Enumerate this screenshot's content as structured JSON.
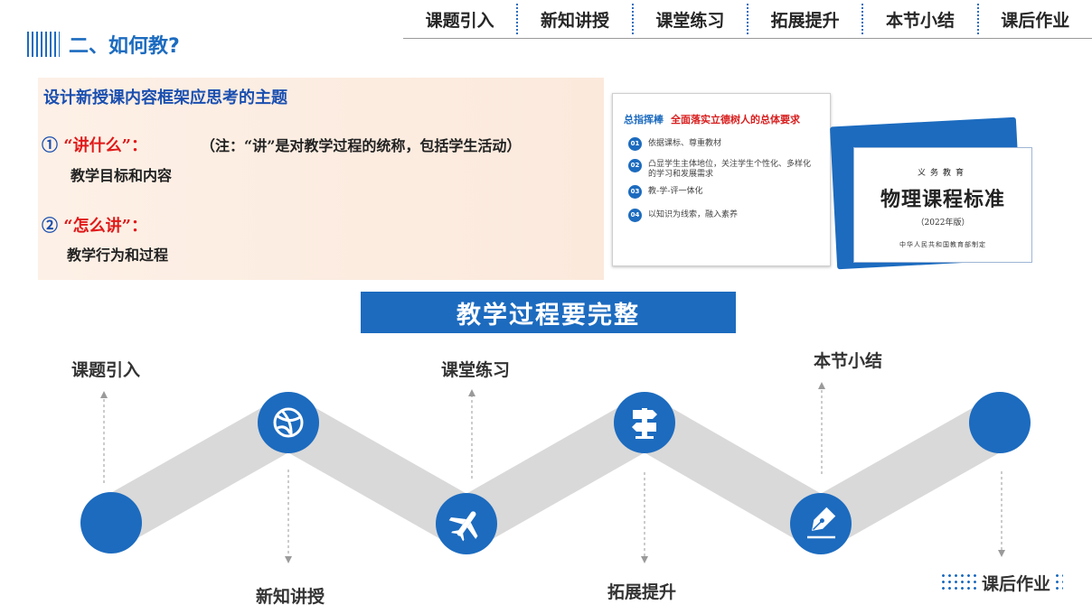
{
  "nav": {
    "tabs": [
      "课题引入",
      "新知讲授",
      "课堂练习",
      "拓展提升",
      "本节小结",
      "课后作业"
    ]
  },
  "heading": {
    "title": "二、如何教?"
  },
  "framework": {
    "title": "设计新授课内容框架应思考的主题",
    "q1_num": "①",
    "q1_label": "“讲什么”：",
    "q1_note": "（注：“讲”是对教学过程的统称，包括学生活动）",
    "q1_answer": "教学目标和内容",
    "q2_num": "②",
    "q2_label": "“怎么讲”：",
    "q2_answer": "教学行为和过程"
  },
  "doc": {
    "title_a": "总指挥棒",
    "title_b": "全面落实立德树人的总体要求",
    "items": [
      {
        "num": "01",
        "text": "依据课标、尊重教材"
      },
      {
        "num": "02",
        "text": "凸显学生主体地位，关注学生个性化、多样化的学习和发展需求"
      },
      {
        "num": "03",
        "text": "教-学-评一体化"
      },
      {
        "num": "04",
        "text": "以知识为线索，融入素养"
      }
    ]
  },
  "book": {
    "line1": "义务教育",
    "line2": "物理课程标准",
    "line3": "（2022年版）",
    "line4": "中华人民共和国教育部制定"
  },
  "banner": {
    "text": "教学过程要完整"
  },
  "process": {
    "steps": [
      "课题引入",
      "新知讲授",
      "课堂练习",
      "拓展提升",
      "本节小结",
      "课后作业"
    ],
    "icons": [
      "basketball-icon",
      "airplane-icon",
      "signpost-icon",
      "pen-icon"
    ]
  },
  "colors": {
    "accent": "#1c6bbf",
    "red": "#e01919",
    "path": "#d9d9d9"
  }
}
